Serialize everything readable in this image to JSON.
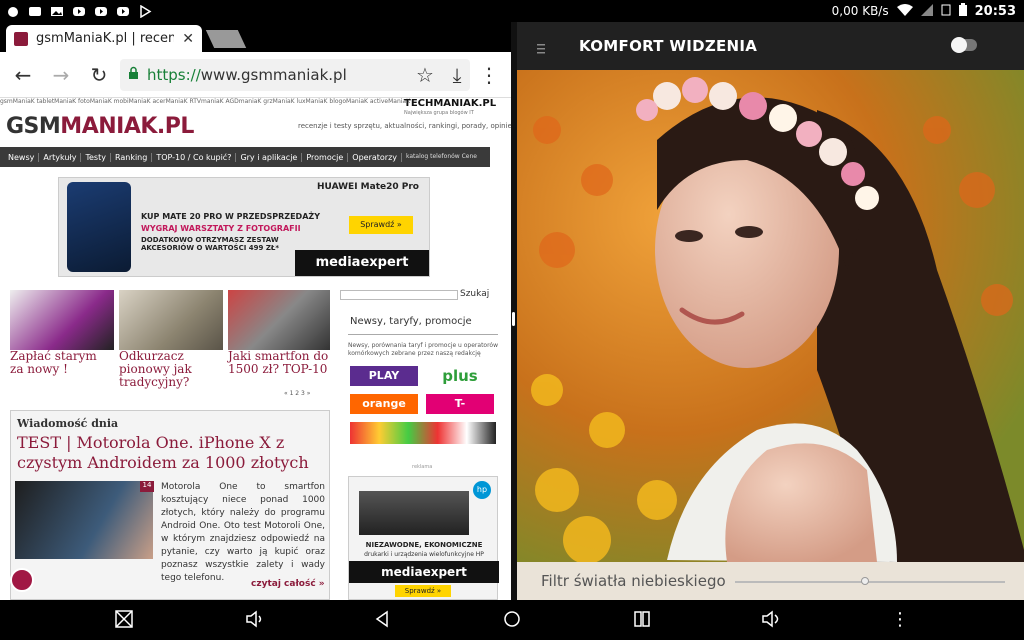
{
  "status_bar": {
    "left_icons": [
      "android-icon",
      "notes-icon",
      "image-icon",
      "youtube-icon",
      "youtube-icon",
      "youtube-icon",
      "play-store-icon"
    ],
    "net_speed": "0,00 KB/s",
    "time": "20:53"
  },
  "browser": {
    "tab_title": "gsmManiaK.pl | recenzje",
    "url_scheme": "https://",
    "url_host": "www.gsmmaniak.pl"
  },
  "site": {
    "topsites": "gsmManiaK  tabletManiaK  fotoManiaK  mobiManiaK  acerManiaK  RTVmaniaK  AGDmaniaK  grzManiaK  luxManiaK  blogoManiaK  activeManiaK",
    "tech_logo": "TECHMANIAK.PL",
    "tech_sub": "Największa grupa blogów IT",
    "logo_pre": "GSM",
    "logo_post": "MANIAK.PL",
    "tagline": "recenzje i testy sprzętu, aktualności, rankingi, porady, opinie",
    "nav": [
      "Newsy",
      "Artykuły",
      "Testy",
      "Ranking",
      "TOP-10 / Co kupić?",
      "Gry i aplikacje",
      "Promocje",
      "Operatorzy"
    ],
    "nav_right": "katalog telefonów  Cene",
    "ad": {
      "brand": "HUAWEI Mate20 Pro",
      "l1": "KUP MATE 20 PRO W PRZEDSPRZEDAŻY",
      "l2": "WYGRAJ WARSZTATY Z FOTOGRAFII",
      "l3": "DODATKOWO OTRZYMASZ ZESTAW AKCESORIÓW O WARTOŚCI 499 ZŁ*",
      "cta": "Sprawdź »",
      "store": "mediaexpert"
    },
    "thumbs": [
      {
        "caption": "Zapłać starym za nowy !"
      },
      {
        "caption": "Odkurzacz pionowy jak tradycyjny?"
      },
      {
        "caption": "Jaki smartfon do 1500 zł? TOP-10"
      }
    ],
    "pager": "« 1 2 3 »",
    "wiadomosc": {
      "label": "Wiadomość dnia",
      "title": "TEST | Motorola One. iPhone X z czystym Androidem za 1000 złotych",
      "badge": "14",
      "text": "Motorola One to smartfon kosztujący niece ponad 1000 złotych, który należy do programu Android One. Oto test Motoroli One, w którym znajdziesz odpowiedź na pytanie, czy warto ją kupić oraz poznasz wszystkie zalety i wady tego telefonu.",
      "more": "czytaj całość »"
    },
    "sidebar": {
      "search_btn": "Szukaj",
      "news_heading": "Newsy, taryfy, promocje",
      "news_text": "Newsy, porównania taryf i promocje u operatorów komórkowych zebrane przez naszą redakcję",
      "operators": [
        {
          "name": "PLAY",
          "color": "#5b2c8f"
        },
        {
          "name": "plus",
          "color": "#2e9e3a"
        },
        {
          "name": "orange",
          "color": "#ff6600"
        },
        {
          "name": "T-",
          "color": "#e20074"
        }
      ],
      "reklama": "reklama",
      "hp_ad": {
        "logo": "hp",
        "l1": "NIEZAWODNE, EKONOMICZNE",
        "l2": "drukarki i urządzenia wielofunkcyjne HP",
        "store": "mediaexpert",
        "cta": "Sprawdź »"
      }
    }
  },
  "comfort_app": {
    "title": "KOMFORT WIDZENIA",
    "toggle_on": false,
    "filter_label": "Filtr światła niebieskiego",
    "filter_level": 0.48
  }
}
